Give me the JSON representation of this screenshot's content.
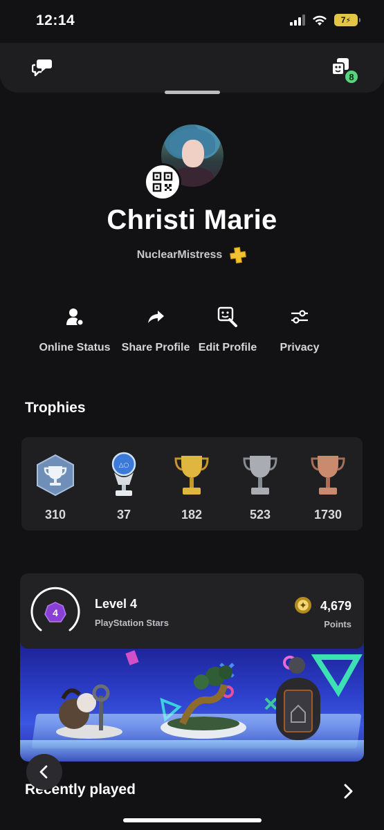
{
  "status_bar": {
    "time": "12:14",
    "battery": "7"
  },
  "header": {
    "notifications_badge": "8"
  },
  "profile": {
    "display_name": "Christi Marie",
    "online_id": "NuclearMistress"
  },
  "actions": [
    {
      "label": "Online Status",
      "icon": "person-status-icon"
    },
    {
      "label": "Share Profile",
      "icon": "share-arrow-icon"
    },
    {
      "label": "Edit Profile",
      "icon": "edit-profile-icon"
    },
    {
      "label": "Privacy",
      "icon": "sliders-icon"
    }
  ],
  "trophies": {
    "title": "Trophies",
    "items": [
      {
        "type": "level",
        "value": "310"
      },
      {
        "type": "platinum",
        "value": "37"
      },
      {
        "type": "gold",
        "value": "182"
      },
      {
        "type": "silver",
        "value": "523"
      },
      {
        "type": "bronze",
        "value": "1730"
      }
    ]
  },
  "stars": {
    "level_number": "4",
    "level_title": "Level 4",
    "subtitle": "PlayStation Stars",
    "points": "4,679",
    "points_label": "Points"
  },
  "recently_played": {
    "title": "Recently played"
  },
  "colors": {
    "background": "#121214",
    "card": "#1f1f22",
    "badge": "#56d47e",
    "stars_purple": "#8a3fd6",
    "banner": "#2c3ec9"
  }
}
